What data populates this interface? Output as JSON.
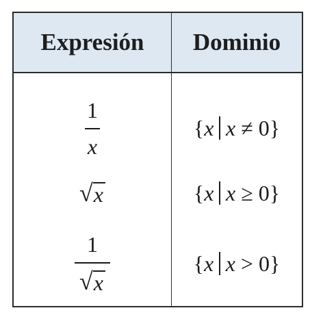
{
  "table": {
    "headers": {
      "expression": "Expresión",
      "domain": "Dominio"
    },
    "rows": [
      {
        "expression": {
          "numerator": "1",
          "denominator": "x"
        },
        "domain": {
          "open": "{",
          "var": "x",
          "bar": "|",
          "var2": "x",
          "relation": "≠",
          "value": "0",
          "close": "}"
        }
      },
      {
        "expression": {
          "radical": "√",
          "radicand": "x"
        },
        "domain": {
          "open": "{",
          "var": "x",
          "bar": "|",
          "var2": "x",
          "relation": "≥",
          "value": "0",
          "close": "}"
        }
      },
      {
        "expression": {
          "numerator": "1",
          "radical": "√",
          "radicand": "x"
        },
        "domain": {
          "open": "{",
          "var": "x",
          "bar": "|",
          "var2": "x",
          "relation": ">",
          "value": "0",
          "close": "}"
        }
      }
    ]
  }
}
